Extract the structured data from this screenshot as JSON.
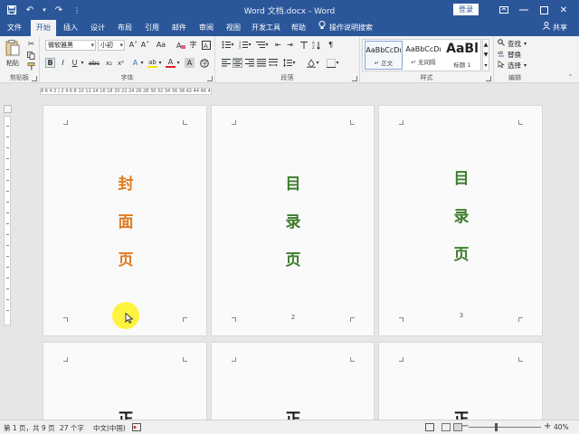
{
  "app": {
    "title": "Word 文档.docx  -  Word",
    "login_label": "登录",
    "share_label": "共享",
    "tell_me": "操作说明搜索"
  },
  "tabs": [
    "文件",
    "开始",
    "插入",
    "设计",
    "布局",
    "引用",
    "邮件",
    "审阅",
    "视图",
    "开发工具",
    "帮助"
  ],
  "active_tab": "开始",
  "ribbon": {
    "clipboard": {
      "label": "剪贴板",
      "paste_label": "粘贴"
    },
    "font": {
      "label": "字体",
      "font_name": "微软雅黑",
      "font_size": "小初",
      "grow": "A˄",
      "shrink": "A˅",
      "case": "Aa",
      "bold": "B",
      "italic": "I",
      "underline": "U",
      "strike": "abc",
      "subscript": "x₂",
      "superscript": "x²",
      "text_effects": "A",
      "highlight": "ab",
      "font_color": "A",
      "char_shading": "A",
      "enclose": "字"
    },
    "paragraph": {
      "label": "段落"
    },
    "styles": {
      "label": "样式",
      "items": [
        {
          "preview": "AaBbCcDı",
          "name": "↵ 正文"
        },
        {
          "preview": "AaBbCcDı",
          "name": "↵ 无间隔"
        },
        {
          "preview": "AaBl",
          "name": "标题 1"
        }
      ]
    },
    "editing": {
      "label": "编辑",
      "find": "查找",
      "replace": "替换",
      "select": "选择"
    }
  },
  "ruler": {
    "text": "8  6  4  2  | 2  4  6  8 10 12 14 16 18 20 22 24 26 28 30 32 34 36 38   42 44 46 48"
  },
  "pages": {
    "p1": {
      "chars": [
        "封",
        "面",
        "页"
      ],
      "color": "#e07a1f"
    },
    "p2": {
      "chars": [
        "目",
        "录",
        "页"
      ],
      "color": "#3e7d2e",
      "number": "2"
    },
    "p3": {
      "chars": [
        "目",
        "录",
        "页"
      ],
      "color": "#3e7d2e",
      "number": "3"
    },
    "p4": {
      "char": "正"
    },
    "p5": {
      "char": "正"
    },
    "p6": {
      "char": "正"
    }
  },
  "status": {
    "page_info": "第 1 页，共 9 页",
    "word_count": "27 个字",
    "language": "中文(中国)",
    "zoom": "40%",
    "zoom_level_percent": 40
  },
  "colors": {
    "brand": "#2b579a",
    "cover_text": "#e07a1f",
    "toc_text": "#3e7d2e",
    "cursor_highlight": "#fff000"
  }
}
